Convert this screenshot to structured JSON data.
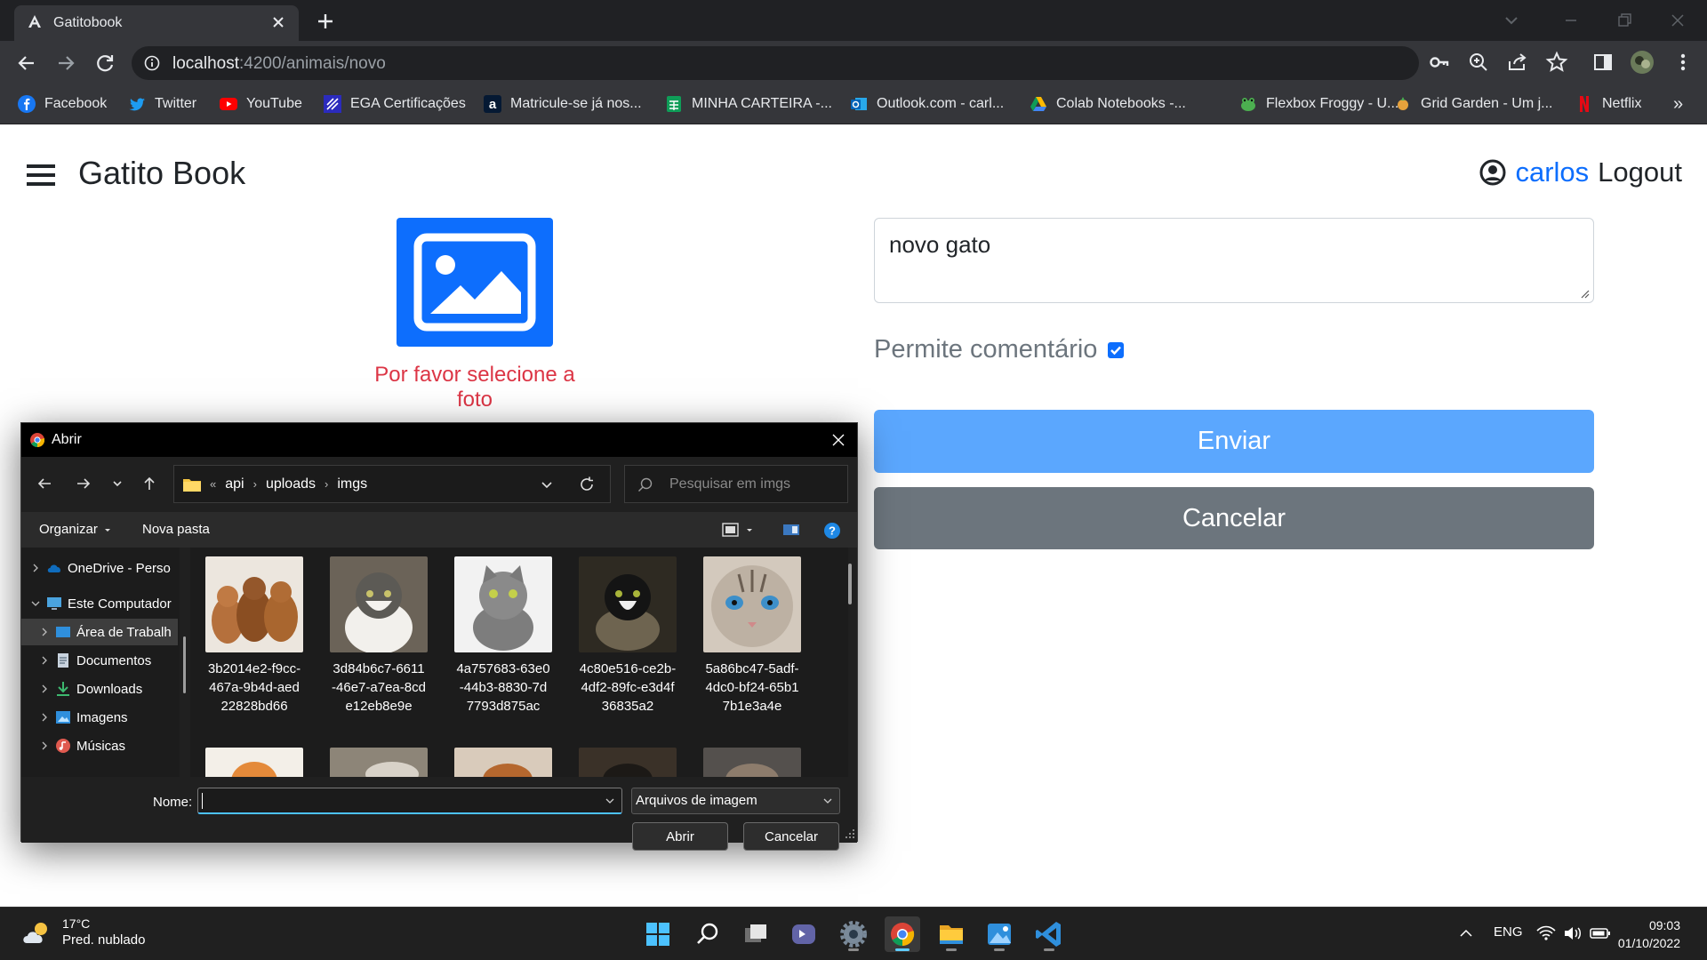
{
  "browser": {
    "tab_title": "Gatitobook",
    "url_host": "localhost",
    "url_path": ":4200/animais/novo",
    "bookmarks": [
      {
        "label": "Facebook",
        "icon": "facebook-icon"
      },
      {
        "label": "Twitter",
        "icon": "twitter-icon"
      },
      {
        "label": "YouTube",
        "icon": "youtube-icon"
      },
      {
        "label": "EGA Certificações",
        "icon": "ega-icon"
      },
      {
        "label": "Matricule-se já nos...",
        "icon": "alura-icon"
      },
      {
        "label": "MINHA CARTEIRA -...",
        "icon": "sheets-icon"
      },
      {
        "label": "Outlook.com - carl...",
        "icon": "outlook-icon"
      },
      {
        "label": "Colab Notebooks -...",
        "icon": "drive-icon"
      },
      {
        "label": "Flexbox Froggy - U...",
        "icon": "frog-icon"
      },
      {
        "label": "Grid Garden - Um j...",
        "icon": "grid-garden-icon"
      },
      {
        "label": "Netflix",
        "icon": "netflix-icon"
      }
    ],
    "overflow": "»"
  },
  "page": {
    "brand": "Gatito Book",
    "user_name": "carlos",
    "logout": "Logout",
    "photo_error": "Por favor selecione a foto",
    "description_value": "novo gato",
    "allow_comments_label": "Permite comentário",
    "allow_comments_checked": true,
    "submit": "Enviar",
    "cancel": "Cancelar",
    "colors": {
      "primary": "#0d6efd",
      "danger": "#dc3545",
      "secondary": "#6c757d",
      "submit_bg": "#5ba7fe"
    }
  },
  "dialog": {
    "title": "Abrir",
    "path": [
      "api",
      "uploads",
      "imgs"
    ],
    "path_overflow": "«",
    "search_placeholder": "Pesquisar em imgs",
    "organize": "Organizar",
    "new_folder": "Nova pasta",
    "tree": [
      {
        "label": "OneDrive - Perso",
        "icon": "onedrive-icon",
        "level": 0,
        "expanded": false
      },
      {
        "label": "Este Computador",
        "icon": "computer-icon",
        "level": 0,
        "expanded": true
      },
      {
        "label": "Área de Trabalh",
        "icon": "desktop-icon",
        "level": 1,
        "selected": true
      },
      {
        "label": "Documentos",
        "icon": "documents-icon",
        "level": 1
      },
      {
        "label": "Downloads",
        "icon": "downloads-icon",
        "level": 1
      },
      {
        "label": "Imagens",
        "icon": "pictures-icon",
        "level": 1
      },
      {
        "label": "Músicas",
        "icon": "music-icon",
        "level": 1
      }
    ],
    "files": [
      {
        "line1": "3b2014e2-f9cc-",
        "line2": "467a-9b4d-aed",
        "line3": "22828bd66",
        "thumb": "three-kittens"
      },
      {
        "line1": "3d84b6c7-6611",
        "line2": "-46e7-a7ea-8cd",
        "line3": "e12eb8e9e",
        "thumb": "tabby-white-cat"
      },
      {
        "line1": "4a757683-63e0",
        "line2": "-44b3-8830-7d",
        "line3": "7793d875ac",
        "thumb": "grey-cat"
      },
      {
        "line1": "4c80e516-ce2b-",
        "line2": "4df2-89fc-e3d4f",
        "line3": "36835a2",
        "thumb": "black-white-cat"
      },
      {
        "line1": "5a86bc47-5adf-",
        "line2": "4dc0-bf24-65b1",
        "line3": "7b1e3a4e",
        "thumb": "blue-eyed-cat"
      }
    ],
    "name_label": "Nome:",
    "name_value": "",
    "file_type": "Arquivos de imagem",
    "open_button": "Abrir",
    "cancel_button": "Cancelar"
  },
  "taskbar": {
    "temperature": "17°C",
    "weather": "Pred. nublado",
    "language": "ENG",
    "time": "09:03",
    "date": "01/10/2022"
  }
}
